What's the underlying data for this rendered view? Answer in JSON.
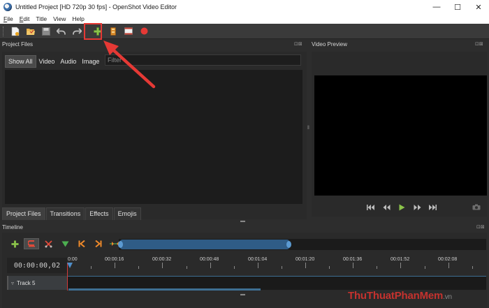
{
  "window": {
    "title": "Untitled Project [HD 720p 30 fps] - OpenShot Video Editor",
    "controls": {
      "minimize": "—",
      "maximize": "☐",
      "close": "✕"
    }
  },
  "menu": [
    {
      "label": "File",
      "mnemonic": "F",
      "rest": "ile"
    },
    {
      "label": "Edit",
      "mnemonic": "E",
      "rest": "dit"
    },
    {
      "label": "Title",
      "mnemonic": "",
      "rest": "Title"
    },
    {
      "label": "View",
      "mnemonic": "",
      "rest": "View"
    },
    {
      "label": "Help",
      "mnemonic": "",
      "rest": "Help"
    }
  ],
  "toolbar": {
    "icons": [
      "new-project-icon",
      "open-project-icon",
      "save-project-icon",
      "undo-icon",
      "redo-icon",
      "import-files-icon",
      "profile-icon",
      "export-icon",
      "record-icon"
    ],
    "highlighted": "import-files-icon"
  },
  "project_files": {
    "title": "Project Files",
    "filter_tabs": [
      "Show All",
      "Video",
      "Audio",
      "Image"
    ],
    "active_filter": "Show All",
    "filter_placeholder": "Filter"
  },
  "bottom_tabs": [
    "Project Files",
    "Transitions",
    "Effects",
    "Emojis"
  ],
  "video_preview": {
    "title": "Video Preview",
    "controls": [
      "jump-start-icon",
      "rewind-icon",
      "play-icon",
      "fast-forward-icon",
      "jump-end-icon"
    ]
  },
  "timeline": {
    "title": "Timeline",
    "timecode": "00:00:00,02",
    "ruler_labels": [
      "0:00",
      "00:00:16",
      "00:00:32",
      "00:00:48",
      "00:01:04",
      "00:01:20",
      "00:01:36",
      "00:01:52",
      "00:02:08"
    ],
    "track_name": "Track 5"
  },
  "watermark": {
    "brand": "ThuThuatPhanMem",
    "domain": ".vn"
  },
  "colors": {
    "accent": "#4f8ec9",
    "highlight": "#e53935",
    "play": "#8bc34a"
  }
}
